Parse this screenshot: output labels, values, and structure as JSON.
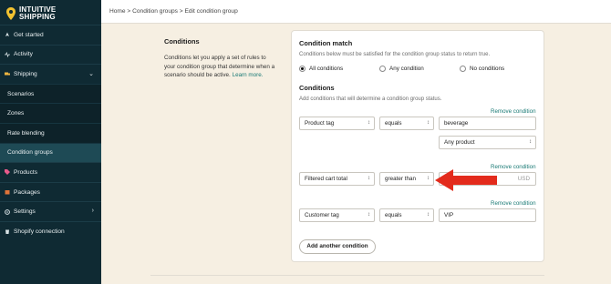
{
  "brand": {
    "line1": "INTUITIVE",
    "line2": "SHIPPING",
    "pin_color": "#f2c230"
  },
  "breadcrumb": "Home > Condition groups > Edit condition group",
  "nav": [
    {
      "label": "Get started",
      "icon": "rocket-icon"
    },
    {
      "label": "Activity",
      "icon": "activity-icon"
    },
    {
      "label": "Shipping",
      "icon": "truck-icon",
      "chevron": "⌄"
    },
    {
      "label": "Scenarios"
    },
    {
      "label": "Zones"
    },
    {
      "label": "Rate blending"
    },
    {
      "label": "Condition groups"
    },
    {
      "label": "Products",
      "icon": "tag-icon"
    },
    {
      "label": "Packages",
      "icon": "box-icon"
    },
    {
      "label": "Settings",
      "icon": "gear-icon",
      "chevron": "›"
    },
    {
      "label": "Shopify connection",
      "icon": "shopify-icon"
    }
  ],
  "description": {
    "title": "Conditions",
    "text": "Conditions let you apply a set of rules to your condition group that determine when a scenario should be active.",
    "link": "Learn more."
  },
  "condition_match": {
    "title": "Condition match",
    "help": "Conditions below must be satisfied for the condition group status to return true.",
    "options": [
      "All conditions",
      "Any condition",
      "No conditions"
    ],
    "selected": "All conditions"
  },
  "conditions": {
    "title": "Conditions",
    "help": "Add conditions that will determine a condition group status.",
    "remove_label": "Remove condition",
    "rows": [
      {
        "field": "Product tag",
        "operator": "equals",
        "value": "beverage",
        "extra": "Any product"
      },
      {
        "field": "Filtered cart total",
        "operator": "greater than",
        "value": "",
        "unit": "USD"
      },
      {
        "field": "Customer tag",
        "operator": "equals",
        "value": "VIP"
      }
    ],
    "add_button": "Add another condition"
  },
  "colors": {
    "sidebar": "#0f2a33",
    "accent": "#1a7a75",
    "arrow": "#e32b1c",
    "page_bg": "#f6efe2"
  }
}
